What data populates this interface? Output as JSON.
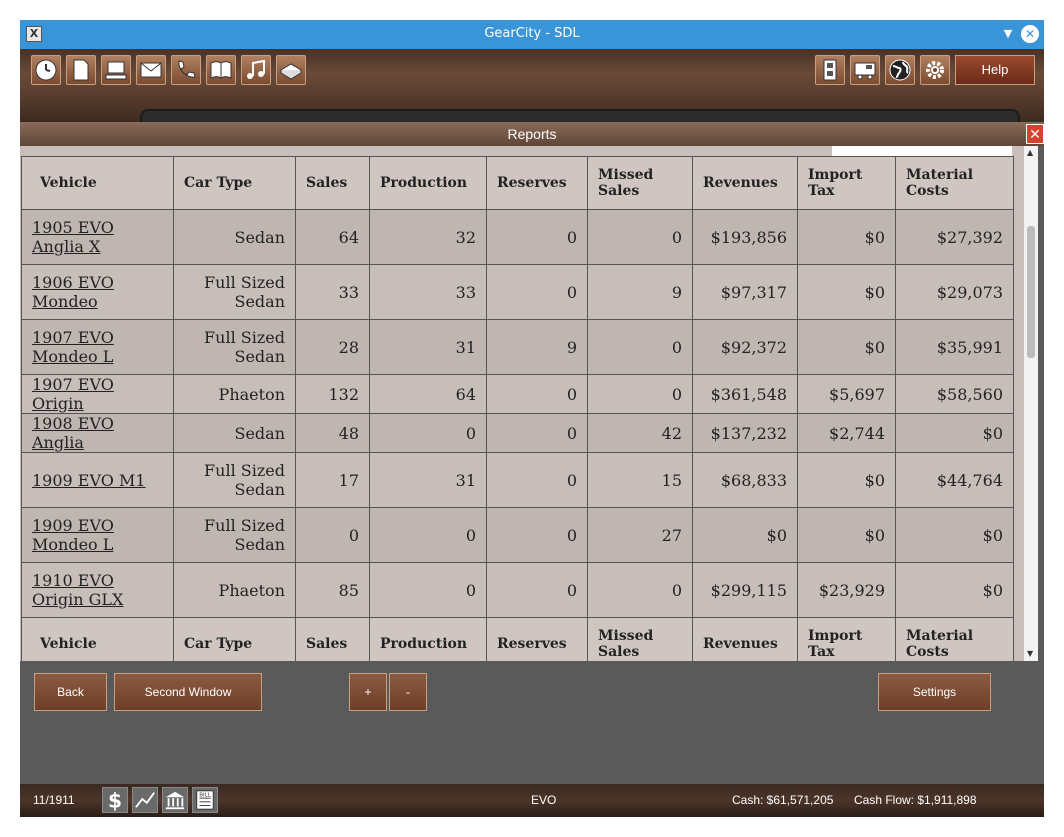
{
  "window": {
    "title": "GearCity - SDL"
  },
  "toolbar": {
    "left_icons": [
      "clock-icon",
      "document-icon",
      "computer-icon",
      "mail-icon",
      "phone-icon",
      "book-icon",
      "music-icon",
      "box-icon"
    ],
    "right_icons": [
      "building-icon",
      "truck-icon",
      "globe-icon",
      "gear-icon"
    ],
    "help_label": "Help"
  },
  "reports": {
    "title": "Reports",
    "headers": [
      "Vehicle",
      "Car Type",
      "Sales",
      "Production",
      "Reserves",
      "Missed Sales",
      "Revenues",
      "Import Tax",
      "Material Costs"
    ],
    "rows": [
      {
        "vehicle": "1905 EVO Anglia X",
        "car_type": "Sedan",
        "sales": "64",
        "production": "32",
        "reserves": "0",
        "missed_sales": "0",
        "revenues": "$193,856",
        "import_tax": "$0",
        "material_costs": "$27,392"
      },
      {
        "vehicle": "1906 EVO Mondeo",
        "car_type": "Full Sized Sedan",
        "sales": "33",
        "production": "33",
        "reserves": "0",
        "missed_sales": "9",
        "revenues": "$97,317",
        "import_tax": "$0",
        "material_costs": "$29,073"
      },
      {
        "vehicle": "1907 EVO Mondeo L",
        "car_type": "Full Sized Sedan",
        "sales": "28",
        "production": "31",
        "reserves": "9",
        "missed_sales": "0",
        "revenues": "$92,372",
        "import_tax": "$0",
        "material_costs": "$35,991"
      },
      {
        "vehicle": "1907 EVO Origin",
        "car_type": "Phaeton",
        "sales": "132",
        "production": "64",
        "reserves": "0",
        "missed_sales": "0",
        "revenues": "$361,548",
        "import_tax": "$5,697",
        "material_costs": "$58,560"
      },
      {
        "vehicle": "1908 EVO Anglia",
        "car_type": "Sedan",
        "sales": "48",
        "production": "0",
        "reserves": "0",
        "missed_sales": "42",
        "revenues": "$137,232",
        "import_tax": "$2,744",
        "material_costs": "$0"
      },
      {
        "vehicle": "1909 EVO M1",
        "car_type": "Full Sized Sedan",
        "sales": "17",
        "production": "31",
        "reserves": "0",
        "missed_sales": "15",
        "revenues": "$68,833",
        "import_tax": "$0",
        "material_costs": "$44,764"
      },
      {
        "vehicle": "1909 EVO Mondeo L",
        "car_type": "Full Sized Sedan",
        "sales": "0",
        "production": "0",
        "reserves": "0",
        "missed_sales": "27",
        "revenues": "$0",
        "import_tax": "$0",
        "material_costs": "$0"
      },
      {
        "vehicle": "1910 EVO Origin GLX",
        "car_type": "Phaeton",
        "sales": "85",
        "production": "0",
        "reserves": "0",
        "missed_sales": "0",
        "revenues": "$299,115",
        "import_tax": "$23,929",
        "material_costs": "$0"
      }
    ]
  },
  "buttons": {
    "back": "Back",
    "second_window": "Second  Window",
    "plus": "+",
    "minus": "-",
    "settings": "Settings"
  },
  "status": {
    "date": "11/1911",
    "icons": [
      "dollar-icon",
      "chart-icon",
      "bank-icon",
      "bill-icon"
    ],
    "company": "EVO",
    "cash": "Cash:  $61,571,205",
    "cash_flow": "Cash  Flow:  $1,911,898"
  }
}
